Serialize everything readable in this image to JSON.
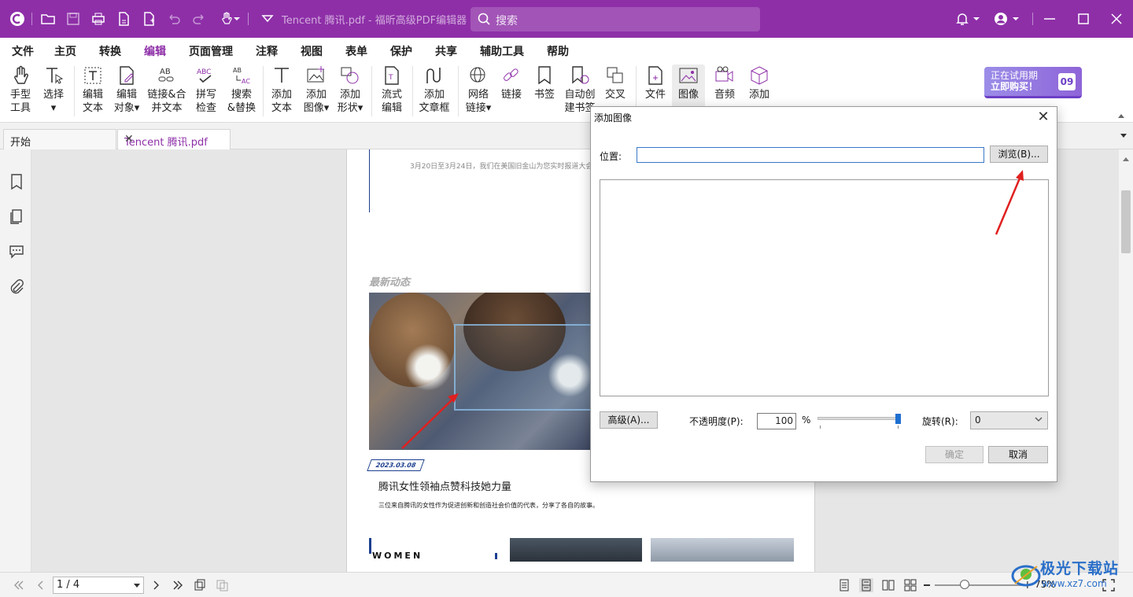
{
  "app": {
    "window_title": "Tencent 腾讯.pdf - 福昕高级PDF编辑器",
    "search_placeholder": "搜索"
  },
  "menu": [
    {
      "label": "文件",
      "active": false
    },
    {
      "label": "主页",
      "active": false
    },
    {
      "label": "转换",
      "active": false
    },
    {
      "label": "编辑",
      "active": true
    },
    {
      "label": "页面管理",
      "active": false
    },
    {
      "label": "注释",
      "active": false
    },
    {
      "label": "视图",
      "active": false
    },
    {
      "label": "表单",
      "active": false
    },
    {
      "label": "保护",
      "active": false
    },
    {
      "label": "共享",
      "active": false
    },
    {
      "label": "辅助工具",
      "active": false
    },
    {
      "label": "帮助",
      "active": false
    }
  ],
  "ribbon": [
    {
      "l1": "手型",
      "l2": "工具",
      "icon": "hand-icon"
    },
    {
      "l1": "选择",
      "l2": "▾",
      "icon": "select-text-icon"
    },
    {
      "l1": "编辑",
      "l2": "文本",
      "icon": "edit-text-icon"
    },
    {
      "l1": "编辑",
      "l2": "对象▾",
      "icon": "edit-object-icon"
    },
    {
      "l1": "链接&合",
      "l2": "并文本",
      "icon": "link-merge-text-icon"
    },
    {
      "l1": "拼写",
      "l2": "检查",
      "icon": "spell-check-icon"
    },
    {
      "l1": "搜索",
      "l2": "&替换",
      "icon": "search-replace-icon"
    },
    {
      "l1": "添加",
      "l2": "文本",
      "icon": "add-text-icon"
    },
    {
      "l1": "添加",
      "l2": "图像▾",
      "icon": "add-image-icon"
    },
    {
      "l1": "添加",
      "l2": "形状▾",
      "icon": "add-shape-icon"
    },
    {
      "l1": "流式",
      "l2": "编辑",
      "icon": "flow-edit-icon"
    },
    {
      "l1": "添加",
      "l2": "文章框",
      "icon": "article-box-icon"
    },
    {
      "l1": "网络",
      "l2": "链接▾",
      "icon": "web-link-icon"
    },
    {
      "l1": "链接",
      "l2": "",
      "icon": "link-icon"
    },
    {
      "l1": "书签",
      "l2": "",
      "icon": "bookmark-icon"
    },
    {
      "l1": "自动创",
      "l2": "建书签",
      "icon": "auto-bookmark-icon"
    },
    {
      "l1": "交叉",
      "l2": "",
      "icon": "cross-icon"
    },
    {
      "l1": "文件",
      "l2": "",
      "icon": "file-icon"
    },
    {
      "l1": "图像",
      "l2": "",
      "icon": "image-icon"
    },
    {
      "l1": "音频",
      "l2": "",
      "icon": "audio-icon"
    },
    {
      "l1": "添加",
      "l2": "",
      "icon": "3d-add-icon"
    }
  ],
  "promo": {
    "line1": "正在试用期",
    "line2": "立即购买！",
    "days": "09"
  },
  "tabs": [
    {
      "label": "开始"
    },
    {
      "label": "Tencent 腾讯.pdf"
    }
  ],
  "page": {
    "date_line": "3月20日至3月24日，我们在美国旧金山为您实时报道大会",
    "section": "最新动态",
    "date_badge": "2023.03.08",
    "article_title": "腾讯女性领袖点赞科技她力量",
    "article_desc": "三位来自腾讯的女性作为促进创新和创造社会价值的代表，分享了各自的故事。",
    "women": "WOMEN"
  },
  "status": {
    "page_indicator": "1 / 4",
    "zoom": "75%"
  },
  "watermark": {
    "name": "极光下载站",
    "url": "www.xz7.com"
  },
  "dialog": {
    "title": "添加图像",
    "location_label": "位置:",
    "location_value": "",
    "browse": "浏览(B)...",
    "advanced": "高级(A)...",
    "opacity_label": "不透明度(P):",
    "opacity_value": "100",
    "opacity_unit": "%",
    "opacity_level_percent": 100,
    "rotation_label": "旋转(R):",
    "rotation_value": "0",
    "ok": "确定",
    "cancel": "取消"
  },
  "colors": {
    "brand": "#8e2fa8",
    "accent_blue": "#1f6fd1",
    "annotation_red": "#e02020"
  }
}
